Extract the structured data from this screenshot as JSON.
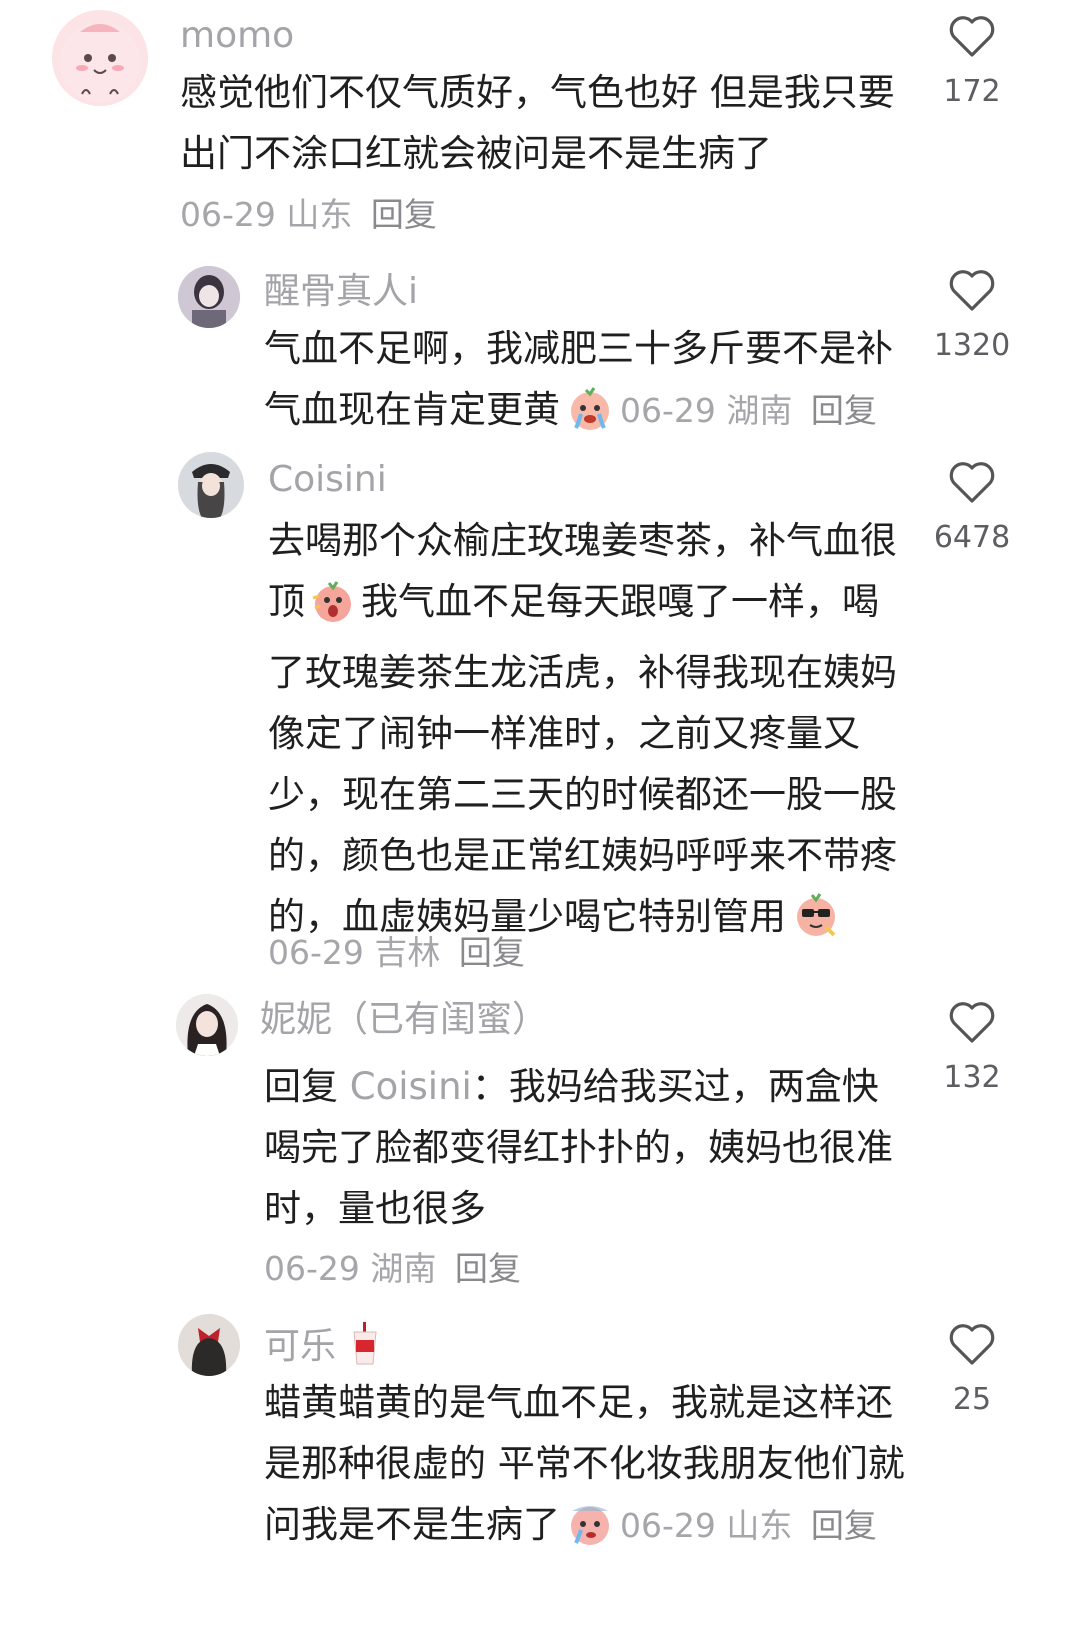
{
  "comments": [
    {
      "username": "momo",
      "text": "感觉他们不仅气质好，气色也好 但是我只要出门不涂口红就会被问是不是生病了",
      "date": "06-29",
      "location": "山东",
      "reply_label": "回复",
      "likes": "172"
    },
    {
      "username": "醒骨真人i",
      "text": "气血不足啊，我减肥三十多斤要不是补气血现在肯定更黄",
      "date": "06-29",
      "location": "湖南",
      "reply_label": "回复",
      "likes": "1320"
    },
    {
      "username": "Coisini",
      "text_a": "去喝那个众榆庄玫瑰姜枣茶，补气血很顶",
      "text_b": "我气血不足每天跟嘎了一样，喝了玫瑰姜茶生龙活虎，补得我现在姨妈像定了闹钟一样准时，之前又疼量又少，现在第二三天的时候都还一股一股的，颜色也是正常红姨妈呼呼来不带疼的，血虚姨妈量少喝它特别管用",
      "date": "06-29",
      "location": "吉林",
      "reply_label": "回复",
      "likes": "6478"
    },
    {
      "username": "妮妮（已有闺蜜）",
      "reply_prefix": "回复",
      "mention": "Coisini",
      "text": "：我妈给我买过，两盒快喝完了脸都变得红扑扑的，姨妈也很准时，量也很多",
      "date": "06-29",
      "location": "湖南",
      "reply_label": "回复",
      "likes": "132"
    },
    {
      "username": "可乐",
      "text": "蜡黄蜡黄的是气血不足，我就是这样还是那种很虚的 平常不化妆我朋友他们就问我是不是生病了",
      "date": "06-29",
      "location": "山东",
      "reply_label": "回复",
      "likes": "25"
    }
  ]
}
